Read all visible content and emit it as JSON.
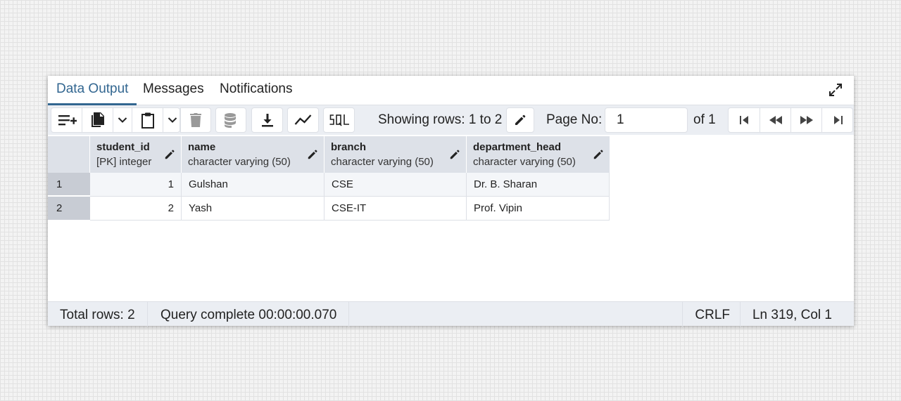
{
  "tabs": [
    "Data Output",
    "Messages",
    "Notifications"
  ],
  "toolbar": {
    "showing_rows": "Showing rows: 1 to 2",
    "page_no_label": "Page No:",
    "page_no_value": "1",
    "of_pages": "of 1"
  },
  "columns": [
    {
      "name": "student_id",
      "type": "[PK] integer"
    },
    {
      "name": "name",
      "type": "character varying (50)"
    },
    {
      "name": "branch",
      "type": "character varying (50)"
    },
    {
      "name": "department_head",
      "type": "character varying (50)"
    }
  ],
  "rows": [
    {
      "num": "1",
      "cells": [
        "1",
        "Gulshan",
        "CSE",
        "Dr. B. Sharan"
      ]
    },
    {
      "num": "2",
      "cells": [
        "2",
        "Yash",
        "CSE-IT",
        "Prof. Vipin"
      ]
    }
  ],
  "status": {
    "total_rows": "Total rows: 2",
    "query": "Query complete 00:00:00.070",
    "line_ending": "CRLF",
    "cursor": "Ln 319, Col 1"
  },
  "colors": {
    "accent": "#326690",
    "toolbar_bg": "#ebeef3",
    "header_bg": "#dde1e8"
  }
}
